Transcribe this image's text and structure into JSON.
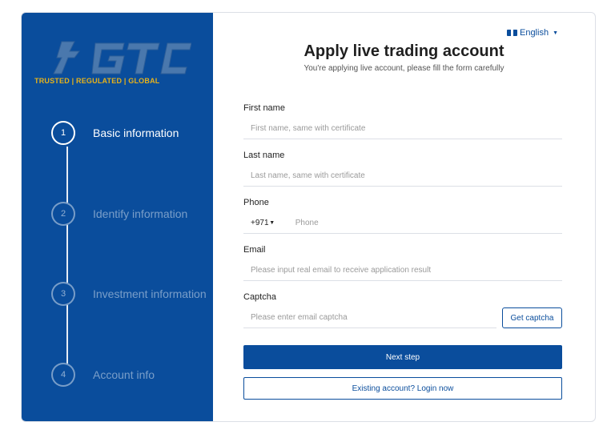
{
  "brand": {
    "logo_text": "GTC",
    "tagline": "TRUSTED | REGULATED | GLOBAL",
    "tagline_color": "#e7b21a",
    "sidebar_color": "#0a4d9c"
  },
  "steps": [
    {
      "num": "1",
      "label": "Basic information",
      "active": true
    },
    {
      "num": "2",
      "label": "Identify information",
      "active": false
    },
    {
      "num": "3",
      "label": "Investment information",
      "active": false
    },
    {
      "num": "4",
      "label": "Account info",
      "active": false
    }
  ],
  "language": {
    "label": "English",
    "icon": "flag-icon"
  },
  "header": {
    "title": "Apply live trading account",
    "subtitle": "You're applying live account, please fill the form carefully"
  },
  "form": {
    "first_name": {
      "label": "First name",
      "placeholder": "First name, same with certificate",
      "value": ""
    },
    "last_name": {
      "label": "Last name",
      "placeholder": "Last name, same with certificate",
      "value": ""
    },
    "phone": {
      "label": "Phone",
      "country_code": "+971",
      "placeholder": "Phone",
      "value": ""
    },
    "email": {
      "label": "Email",
      "placeholder": "Please input real email to receive application result",
      "value": ""
    },
    "captcha": {
      "label": "Captcha",
      "placeholder": "Please enter email captcha",
      "value": "",
      "button_label": "Get captcha"
    }
  },
  "actions": {
    "next_label": "Next step",
    "login_label": "Existing account? Login now"
  }
}
